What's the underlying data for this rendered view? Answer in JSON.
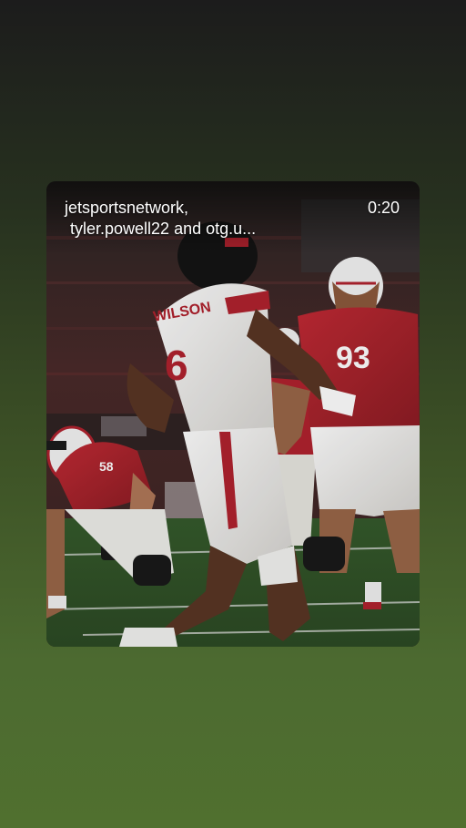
{
  "story": {
    "accounts_line1": "jetsportsnetwork,",
    "accounts_line2": "tyler.powell22 and otg.u...",
    "timer": "0:20"
  },
  "players": {
    "qb_number": "6",
    "qb_name": "WILSON",
    "lineman_number": "58",
    "dlineman_number": "93"
  },
  "colors": {
    "background_top": "#1c1c1c",
    "background_bottom": "#50702f",
    "jersey_red": "#b0222e",
    "jersey_white": "#f2f2f0",
    "turf_green": "#3e6a33"
  }
}
